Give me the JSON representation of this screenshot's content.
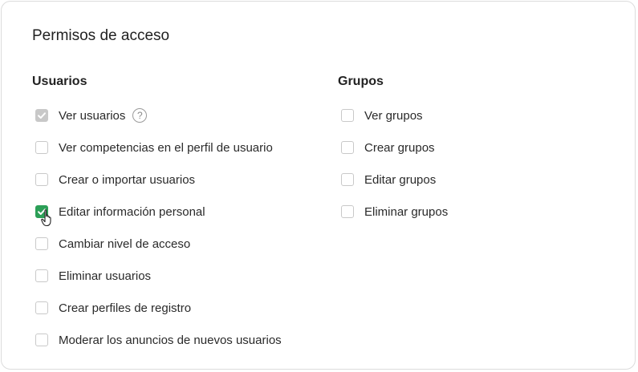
{
  "panel": {
    "title": "Permisos de acceso"
  },
  "users": {
    "heading": "Usuarios",
    "help_symbol": "?",
    "items": [
      {
        "label": "Ver usuarios",
        "state": "checked-disabled"
      },
      {
        "label": "Ver competencias en el perfil de usuario",
        "state": "unchecked"
      },
      {
        "label": "Crear o importar usuarios",
        "state": "unchecked"
      },
      {
        "label": "Editar información personal",
        "state": "checked"
      },
      {
        "label": "Cambiar nivel de acceso",
        "state": "unchecked"
      },
      {
        "label": "Eliminar usuarios",
        "state": "unchecked"
      },
      {
        "label": "Crear perfiles de registro",
        "state": "unchecked"
      },
      {
        "label": "Moderar los anuncios de nuevos usuarios",
        "state": "unchecked"
      }
    ]
  },
  "groups": {
    "heading": "Grupos",
    "items": [
      {
        "label": "Ver grupos",
        "state": "unchecked"
      },
      {
        "label": "Crear grupos",
        "state": "unchecked"
      },
      {
        "label": "Editar grupos",
        "state": "unchecked"
      },
      {
        "label": "Eliminar grupos",
        "state": "unchecked"
      }
    ]
  },
  "colors": {
    "checked": "#2c9f57",
    "disabled": "#c8c8c8",
    "border": "#c9c9c9"
  },
  "icons": {
    "check": "check-icon",
    "help": "help-circle-icon",
    "cursor": "hand-pointer-icon"
  }
}
